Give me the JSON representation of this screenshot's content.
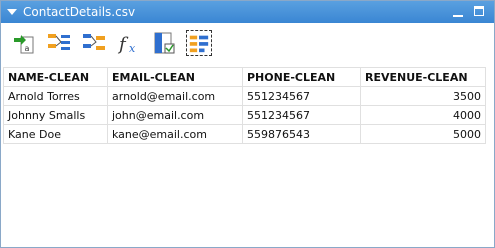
{
  "window": {
    "title": "ContactDetails.csv"
  },
  "toolbar": {
    "buttons": [
      {
        "icon": "import-icon"
      },
      {
        "icon": "split-columns-icon"
      },
      {
        "icon": "merge-columns-icon"
      },
      {
        "icon": "function-icon"
      },
      {
        "icon": "validate-column-icon"
      },
      {
        "icon": "clean-data-icon"
      }
    ]
  },
  "table": {
    "headers": [
      "NAME-CLEAN",
      "EMAIL-CLEAN",
      "PHONE-CLEAN",
      "REVENUE-CLEAN"
    ],
    "rows": [
      [
        "Arnold Torres",
        "arnold@email.com",
        "551234567",
        "3500"
      ],
      [
        "Johnny Smalls",
        "john@email.com",
        "551234567",
        "4000"
      ],
      [
        "Kane Doe",
        "kane@email.com",
        "559876543",
        "5000"
      ]
    ]
  },
  "colors": {
    "titlebar": "#3a86d3",
    "accent_orange": "#f0a020",
    "accent_blue": "#2f6fcf",
    "accent_green": "#2a9a2a"
  }
}
